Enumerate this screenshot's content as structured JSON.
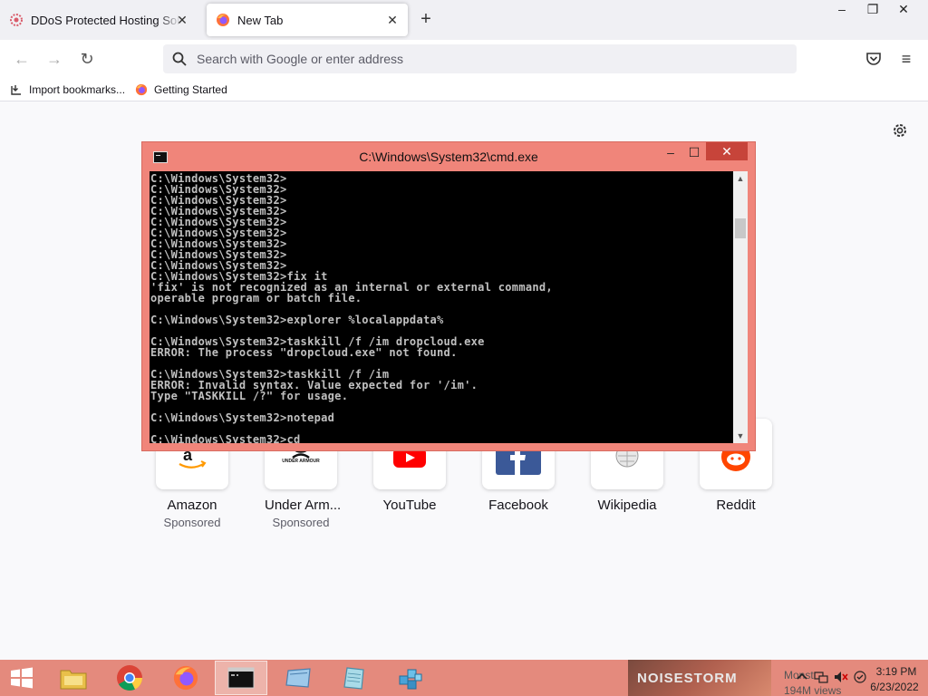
{
  "browser": {
    "tabs": [
      {
        "title": "DDoS Protected Hosting Solutio",
        "active": false
      },
      {
        "title": "New Tab",
        "active": true
      }
    ],
    "url_placeholder": "Search with Google or enter address",
    "bookmarks": [
      {
        "label": "Import bookmarks..."
      },
      {
        "label": "Getting Started"
      }
    ]
  },
  "top_sites": [
    {
      "label": "Amazon",
      "sub": "Sponsored",
      "icon": "amazon-icon"
    },
    {
      "label": "Under Arm...",
      "sub": "Sponsored",
      "icon": "under-armour-icon"
    },
    {
      "label": "YouTube",
      "sub": "",
      "icon": "youtube-icon"
    },
    {
      "label": "Facebook",
      "sub": "",
      "icon": "facebook-icon"
    },
    {
      "label": "Wikipedia",
      "sub": "",
      "icon": "wikipedia-icon"
    },
    {
      "label": "Reddit",
      "sub": "",
      "icon": "reddit-icon"
    }
  ],
  "top_sites_thumbs": {
    "under_armour_text": "UNDER ARMOUR"
  },
  "cmd": {
    "title": "C:\\Windows\\System32\\cmd.exe",
    "output": "C:\\Windows\\System32>\nC:\\Windows\\System32>\nC:\\Windows\\System32>\nC:\\Windows\\System32>\nC:\\Windows\\System32>\nC:\\Windows\\System32>\nC:\\Windows\\System32>\nC:\\Windows\\System32>\nC:\\Windows\\System32>\nC:\\Windows\\System32>fix it\n'fix' is not recognized as an internal or external command,\noperable program or batch file.\n\nC:\\Windows\\System32>explorer %localappdata%\n\nC:\\Windows\\System32>taskkill /f /im dropcloud.exe\nERROR: The process \"dropcloud.exe\" not found.\n\nC:\\Windows\\System32>taskkill /f /im\nERROR: Invalid syntax. Value expected for '/im'.\nType \"TASKKILL /?\" for usage.\n\nC:\\Windows\\System32>notepad\n\nC:\\Windows\\System32>cd"
  },
  "taskbar": {
    "thumbnail_brand": "NOISESTORM",
    "thumbnail_views": "194M views",
    "thumbnail_partial": "Monst",
    "time": "3:19 PM",
    "date": "6/23/2022"
  },
  "colors": {
    "accent_window": "#f0857a",
    "taskbar": "#e48a7d",
    "console_bg": "#000000",
    "console_text": "#c0c0c0"
  }
}
